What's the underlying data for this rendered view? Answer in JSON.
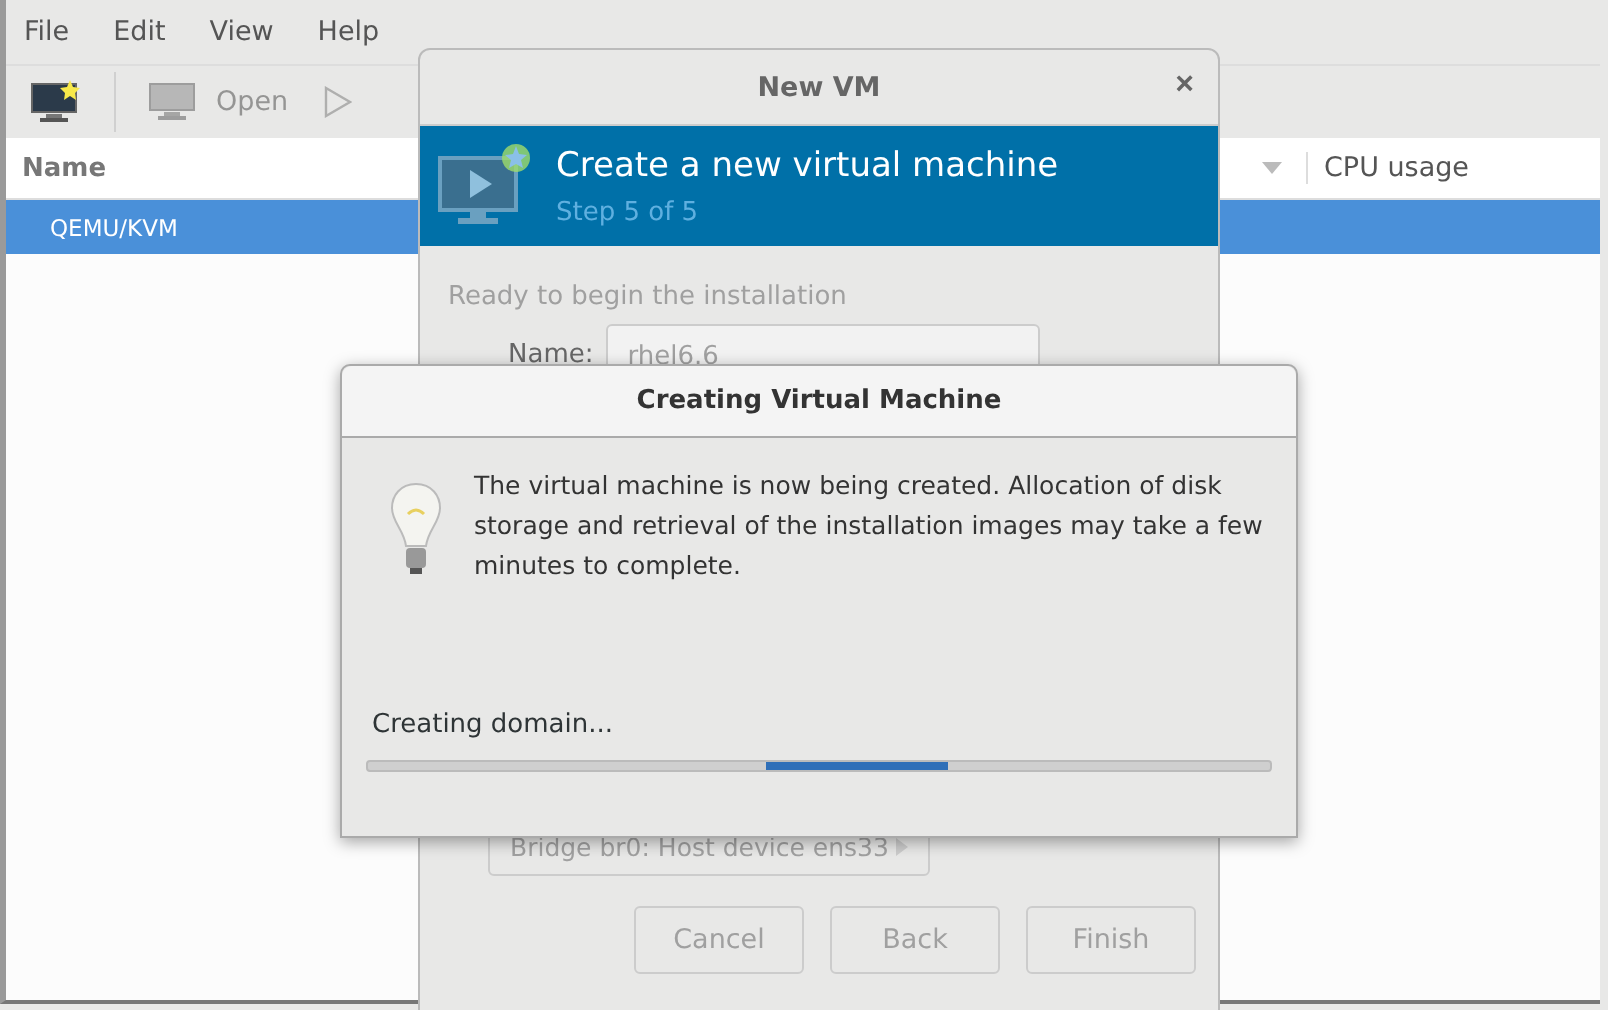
{
  "menu": [
    "File",
    "Edit",
    "View",
    "Help"
  ],
  "toolbar": [
    {
      "kind": "new",
      "disabled": false
    },
    {
      "kind": "open",
      "label": "Open",
      "disabled": true
    },
    {
      "kind": "run",
      "disabled": true
    }
  ],
  "table": {
    "columns": [
      "Name",
      "CPU usage"
    ],
    "rows": [
      {
        "name": "QEMU/KVM",
        "selected": true
      }
    ]
  },
  "new_vm_dialog": {
    "title": "New VM",
    "close": "×",
    "header_title": "Create a new virtual machine",
    "header_step": "Step 5 of 5",
    "ready_text": "Ready to begin the installation",
    "name_label": "Name:",
    "name_value": "rhel6.6",
    "network_value": "Bridge br0: Host device ens33",
    "buttons": [
      {
        "label": "Cancel",
        "disabled": true
      },
      {
        "label": "Back",
        "disabled": true
      },
      {
        "label": "Finish",
        "disabled": true
      }
    ]
  },
  "progress_dialog": {
    "title": "Creating Virtual Machine",
    "message": "The virtual machine is now being created. Allocation of disk storage and retrieval of the installation images may take a few minutes to complete.",
    "status": "Creating domain...",
    "indeterminate": true
  }
}
